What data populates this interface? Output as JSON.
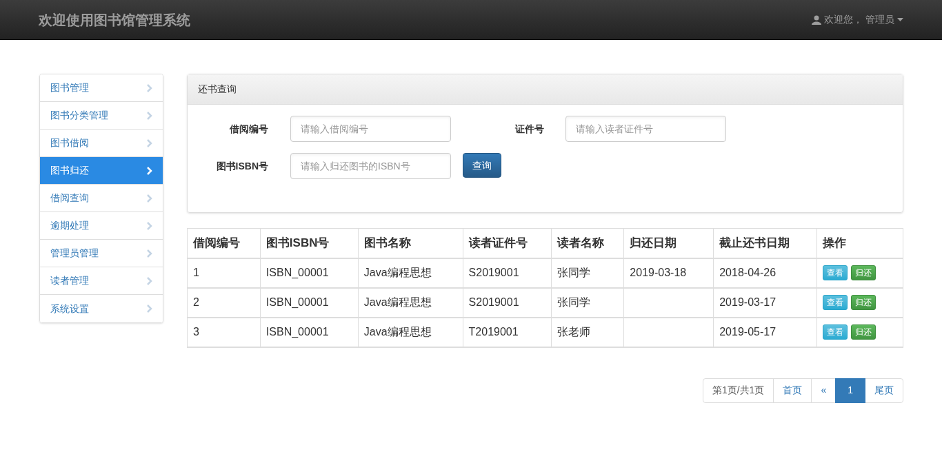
{
  "navbar": {
    "brand": "欢迎使用图书馆管理系统",
    "user_menu": "欢迎您， 管理员"
  },
  "sidebar": {
    "items": [
      {
        "label": "图书管理",
        "selected": false
      },
      {
        "label": "图书分类管理",
        "selected": false
      },
      {
        "label": "图书借阅",
        "selected": false
      },
      {
        "label": "图书归还",
        "selected": true
      },
      {
        "label": "借阅查询",
        "selected": false
      },
      {
        "label": "逾期处理",
        "selected": false
      },
      {
        "label": "管理员管理",
        "selected": false
      },
      {
        "label": "读者管理",
        "selected": false
      },
      {
        "label": "系统设置",
        "selected": false
      }
    ]
  },
  "search_panel": {
    "title": "还书查询",
    "fields": [
      {
        "label": "借阅编号",
        "placeholder": "请输入借阅编号"
      },
      {
        "label": "证件号",
        "placeholder": "请输入读者证件号"
      },
      {
        "label": "图书ISBN号",
        "placeholder": "请输入归还图书的ISBN号"
      }
    ],
    "button": "查询"
  },
  "table": {
    "columns": [
      "借阅编号",
      "图书ISBN号",
      "图书名称",
      "读者证件号",
      "读者名称",
      "归还日期",
      "截止还书日期",
      "操作"
    ],
    "rows": [
      {
        "cells": [
          "1",
          "ISBN_00001",
          "Java编程思想",
          "S2019001",
          "张同学",
          "2019-03-18",
          "2018-04-26"
        ],
        "actions": [
          {
            "label": "查看",
            "kind": "view"
          },
          {
            "label": "归还",
            "kind": "return"
          }
        ]
      },
      {
        "cells": [
          "2",
          "ISBN_00001",
          "Java编程思想",
          "S2019001",
          "张同学",
          "",
          "2019-03-17"
        ],
        "actions": [
          {
            "label": "查看",
            "kind": "view"
          },
          {
            "label": "归还",
            "kind": "return"
          }
        ]
      },
      {
        "cells": [
          "3",
          "ISBN_00001",
          "Java编程思想",
          "T2019001",
          "张老师",
          "",
          "2019-05-17"
        ],
        "actions": [
          {
            "label": "查看",
            "kind": "view"
          },
          {
            "label": "归还",
            "kind": "return"
          }
        ]
      }
    ]
  },
  "pagination": [
    {
      "label": "第1页/共1页",
      "kind": "info",
      "selected": false
    },
    {
      "label": "首页",
      "kind": "link",
      "selected": false
    },
    {
      "label": "«",
      "kind": "link",
      "selected": false
    },
    {
      "label": "1",
      "kind": "link",
      "selected": true
    },
    {
      "label": "尾页",
      "kind": "link",
      "selected": false
    }
  ]
}
